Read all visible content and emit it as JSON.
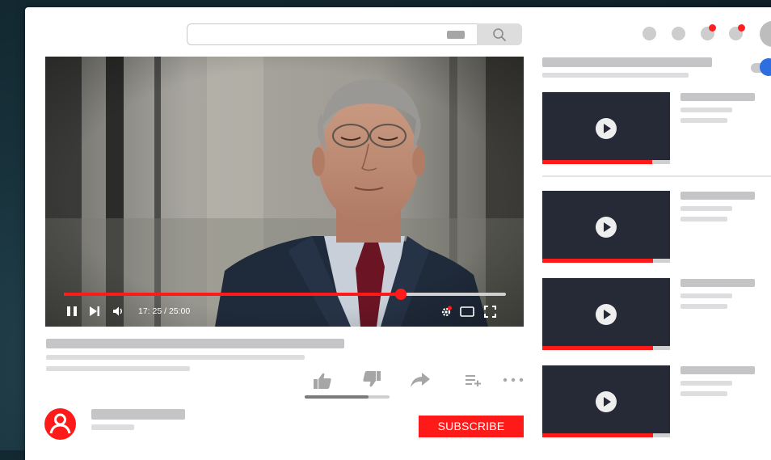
{
  "player": {
    "time_display": "17: 25 / 25:00",
    "progress_fraction": 0.762,
    "buffered_fraction": 1.0
  },
  "actions": {
    "like_ratio": 0.75
  },
  "channel": {
    "subscribe_label": "SUBSCRIBE"
  },
  "sidebar": {
    "autoplay_on": true,
    "videos": [
      {
        "watched_fraction": 0.86
      },
      {
        "watched_fraction": 0.87
      },
      {
        "watched_fraction": 0.87
      },
      {
        "watched_fraction": 0.87
      }
    ]
  },
  "header": {
    "notification_icons": [
      "upload-icon",
      "apps-icon",
      "messages-icon",
      "bell-icon"
    ]
  },
  "colors": {
    "accent": "#ff1a1a",
    "toggle": "#2d6ee0",
    "thumbnail": "#262a36",
    "placeholder": "#c5c5c8"
  }
}
